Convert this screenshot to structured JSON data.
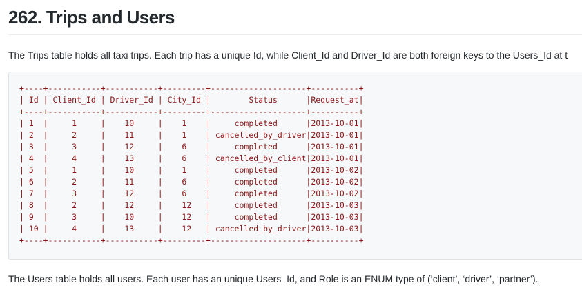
{
  "heading": "262. Trips and Users",
  "intro_text": "The Trips table holds all taxi trips. Each trip has a unique Id, while Client_Id and Driver_Id are both foreign keys to the Users_Id at t",
  "trips_table": {
    "border_top": "+----+-----------+-----------+---------+--------------------+----------+",
    "header": "| Id | Client_Id | Driver_Id | City_Id |        Status      |Request_at|",
    "separator": "+----+-----------+-----------+---------+--------------------+----------+",
    "rows": [
      "| 1  |     1     |    10     |    1    |     completed      |2013-10-01|",
      "| 2  |     2     |    11     |    1    | cancelled_by_driver|2013-10-01|",
      "| 3  |     3     |    12     |    6    |     completed      |2013-10-01|",
      "| 4  |     4     |    13     |    6    | cancelled_by_client|2013-10-01|",
      "| 5  |     1     |    10     |    1    |     completed      |2013-10-02|",
      "| 6  |     2     |    11     |    6    |     completed      |2013-10-02|",
      "| 7  |     3     |    12     |    6    |     completed      |2013-10-02|",
      "| 8  |     2     |    12     |    12   |     completed      |2013-10-03|",
      "| 9  |     3     |    10     |    12   |     completed      |2013-10-03|",
      "| 10 |     4     |    13     |    12   | cancelled_by_driver|2013-10-03|"
    ],
    "border_bottom": "+----+-----------+-----------+---------+--------------------+----------+"
  },
  "users_text": "The Users table holds all users. Each user has an unique Users_Id, and Role is an ENUM type of (‘client’, ‘driver’, ‘partner’)."
}
